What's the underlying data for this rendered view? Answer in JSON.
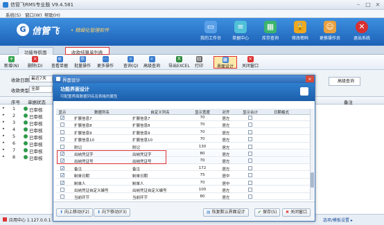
{
  "app": {
    "title": "信管飞RMS专业版 V9.4.581"
  },
  "menu": [
    "系统(S)",
    "窗口(W)",
    "帮助(H)"
  ],
  "banner": {
    "brand": "信管飞",
    "slogan": "• 精细化管理软件",
    "buttons": [
      "我的工作台",
      "单据中心",
      "库存查询",
      "修改密码",
      "更换操作员",
      "退出系统"
    ]
  },
  "tabs": [
    "功能导航面",
    "收款结算单列表"
  ],
  "toolbar": [
    "新增(N)",
    "删除(D)",
    "查看单据",
    "批量操作",
    "更多操作",
    "查询(Q)",
    "高级查询",
    "导出EXCEL",
    "打印",
    "界面设计",
    "关闭窗口"
  ],
  "filter": {
    "date_label": "收款日期",
    "date_value": "最近7天",
    "type_label": "收款类型",
    "type_value": "全部",
    "advanced_query": "高级查询"
  },
  "grid": {
    "headers": [
      "序号",
      "单据状态",
      "备注"
    ],
    "rows": [
      {
        "n": "1",
        "s": "已审核"
      },
      {
        "n": "2",
        "s": "已审核"
      },
      {
        "n": "3",
        "s": "已审核"
      },
      {
        "n": "4",
        "s": "已审核"
      },
      {
        "n": "5",
        "s": "已审核"
      },
      {
        "n": "6",
        "s": "已审核"
      },
      {
        "n": "7",
        "s": "已审核"
      },
      {
        "n": "8",
        "s": "已审核"
      }
    ]
  },
  "status": {
    "left": "应用中心 1.127.0.0.1",
    "right": "选项/模板设置 ▸"
  },
  "dialog": {
    "title": "界面设计",
    "heading": "功能界面设计",
    "subheading": "可配置界面数据列名及表格的属性",
    "columns": [
      "显示",
      "数据列名",
      "自定义列名",
      "显示宽度",
      "对齐",
      "显示合计",
      "日期格式"
    ],
    "rows": [
      {
        "show": true,
        "name": "扩展信息7",
        "custom": "扩展信息7",
        "width": "70",
        "align": "居左",
        "sum": false,
        "hl": false
      },
      {
        "show": false,
        "name": "扩展信息8",
        "custom": "扩展信息8",
        "width": "70",
        "align": "居左",
        "sum": false,
        "hl": false
      },
      {
        "show": false,
        "name": "扩展信息9",
        "custom": "扩展信息9",
        "width": "70",
        "align": "居左",
        "sum": false,
        "hl": false
      },
      {
        "show": false,
        "name": "扩展信息10",
        "custom": "扩展信息10",
        "width": "70",
        "align": "居左",
        "sum": false,
        "hl": false
      },
      {
        "show": false,
        "name": "附记",
        "custom": "附记",
        "width": "130",
        "align": "居左",
        "sum": false,
        "hl": false
      },
      {
        "show": true,
        "name": "出纳凭证字",
        "custom": "出纳凭证字",
        "width": "80",
        "align": "居左",
        "sum": false,
        "hl": true
      },
      {
        "show": true,
        "name": "出纳凭证号",
        "custom": "出纳凭证号",
        "width": "70",
        "align": "居左",
        "sum": false,
        "hl": true
      },
      {
        "show": true,
        "name": "备注",
        "custom": "备注",
        "width": "172",
        "align": "居左",
        "sum": false,
        "hl": false
      },
      {
        "show": true,
        "name": "制单日期",
        "custom": "制单日期",
        "width": "75",
        "align": "居中",
        "sum": false,
        "hl": false
      },
      {
        "show": true,
        "name": "制单人",
        "custom": "制单人",
        "width": "70",
        "align": "居中",
        "sum": false,
        "hl": false
      },
      {
        "show": false,
        "name": "出纳凭证自定义编号",
        "custom": "出纳凭证自定义编号",
        "width": "100",
        "align": "居左",
        "sum": false,
        "hl": false
      },
      {
        "show": false,
        "name": "当前环节",
        "custom": "当前环节",
        "width": "80",
        "align": "居左",
        "sum": false,
        "hl": false
      }
    ],
    "buttons": {
      "up": "向上移动(F2)",
      "down": "向下移动(F3)",
      "restore": "恢复默认界面设计",
      "save": "保存(S)",
      "close": "关闭窗口"
    }
  }
}
